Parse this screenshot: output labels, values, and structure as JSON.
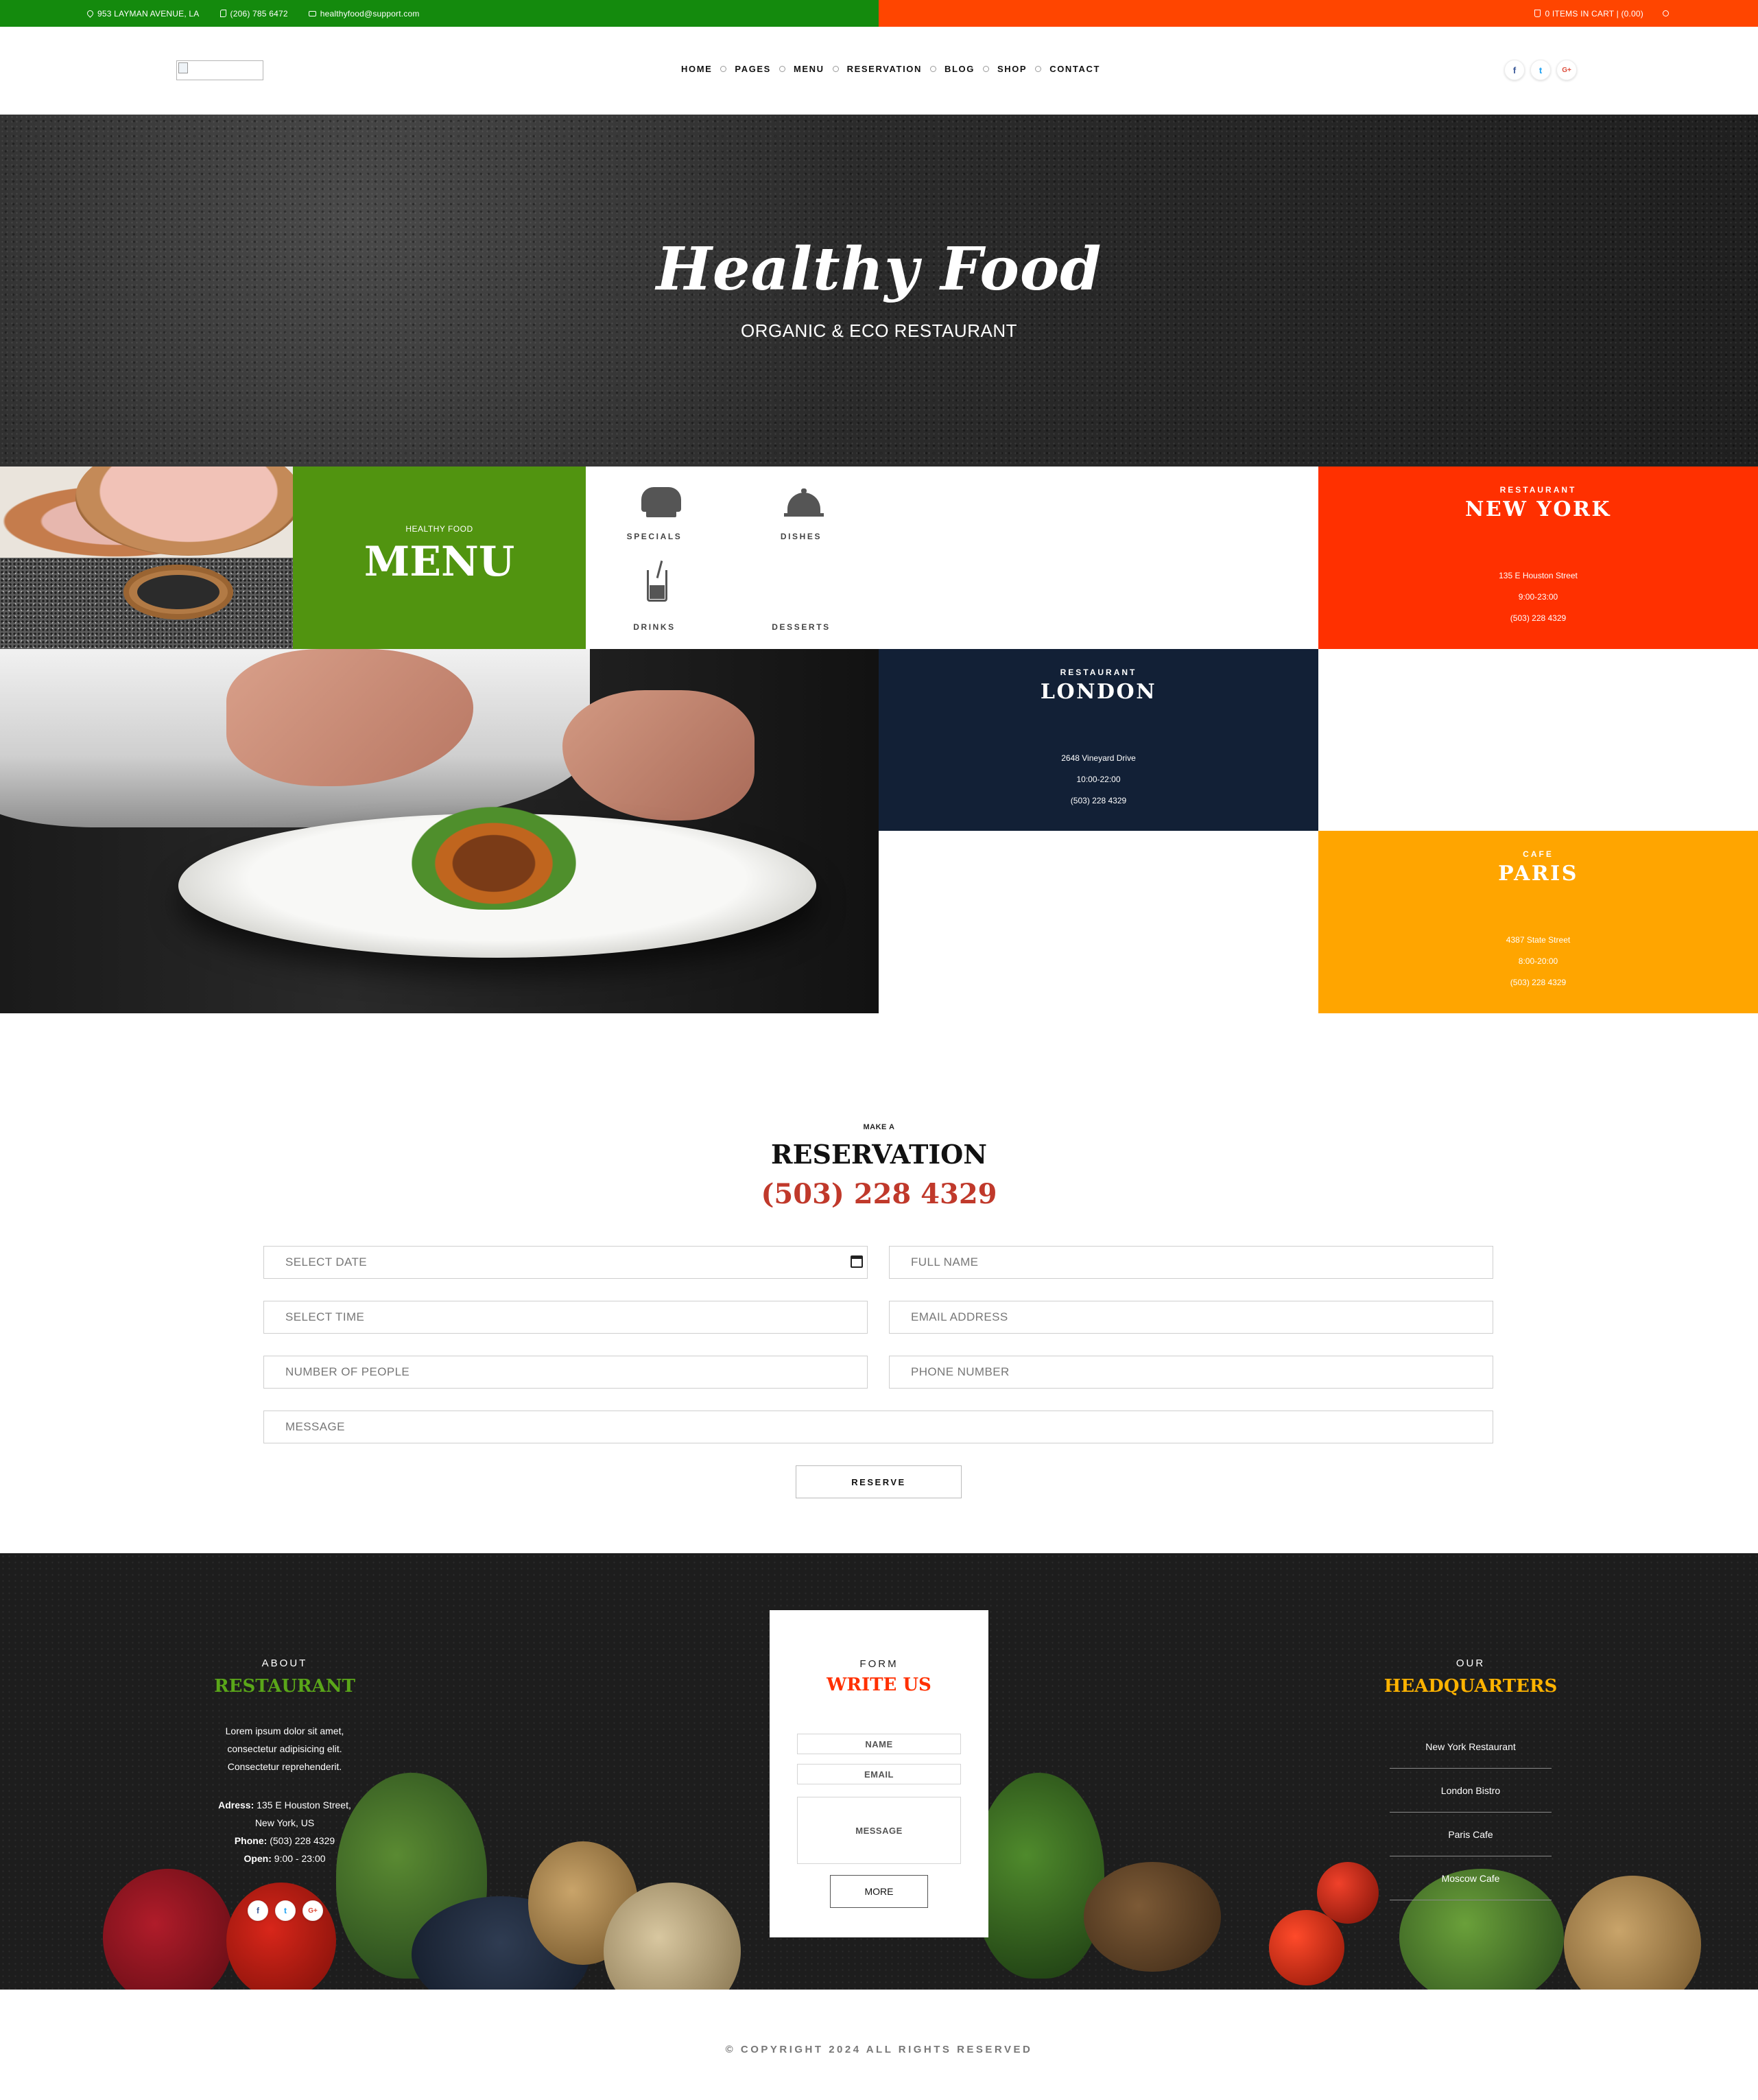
{
  "topbar": {
    "address": "953 LAYMAN AVENUE, LA",
    "phone": "(206) 785 6472",
    "email": "healthyfood@support.com",
    "cart": "0 ITEMS IN CART | (0.00)",
    "colors": {
      "left": "#148a0d",
      "right": "#ff4500"
    }
  },
  "header": {
    "nav": [
      "HOME",
      "PAGES",
      "MENU",
      "RESERVATION",
      "BLOG",
      "SHOP",
      "CONTACT"
    ],
    "social": [
      "f",
      "t",
      "G+"
    ]
  },
  "hero": {
    "title": "Healthy Food",
    "subtitle": "ORGANIC & ECO RESTAURANT"
  },
  "menu_tile": {
    "kicker": "HEALTHY FOOD",
    "title": "MENU",
    "color": "#519410"
  },
  "categories": [
    {
      "label": "SPECIALS",
      "icon": "chef-hat-icon"
    },
    {
      "label": "DISHES",
      "icon": "cloche-icon"
    },
    {
      "label": "DRINKS",
      "icon": "drink-cup-icon"
    },
    {
      "label": "DESSERTS",
      "icon": "dessert-icon"
    }
  ],
  "locations": {
    "new_york": {
      "kicker": "RESTAURANT",
      "name": "NEW YORK",
      "address": "135 E Houston Street",
      "hours": "9:00-23:00",
      "phone": "(503) 228 4329",
      "color": "#ff3000"
    },
    "london": {
      "kicker": "RESTAURANT",
      "name": "LONDON",
      "address": "2648 Vineyard Drive",
      "hours": "10:00-22:00",
      "phone": "(503) 228 4329",
      "color": "#122036"
    },
    "paris": {
      "kicker": "CAFE",
      "name": "PARIS",
      "address": "4387 State Street",
      "hours": "8:00-20:00",
      "phone": "(503) 228 4329",
      "color": "#ffa500"
    }
  },
  "reservation": {
    "kicker": "MAKE A",
    "title": "RESERVATION",
    "phone": "(503) 228 4329",
    "fields": {
      "date": "SELECT DATE",
      "full_name": "FULL NAME",
      "time": "SELECT TIME",
      "email": "EMAIL ADDRESS",
      "people": "NUMBER OF PEOPLE",
      "phone": "PHONE NUMBER",
      "message": "MESSAGE"
    },
    "button": "RESERVE"
  },
  "footer": {
    "about": {
      "kicker": "ABOUT",
      "title": "RESTAURANT",
      "text1": "Lorem ipsum dolor sit amet,",
      "text2": "consectetur adipisicing elit.",
      "text3": "Consectetur reprehenderit.",
      "address_label": "Adress:",
      "address": "135 E Houston Street,",
      "city": "New York, US",
      "phone_label": "Phone:",
      "phone": "(503) 228 4329",
      "open_label": "Open:",
      "open": "9:00 - 23:00",
      "title_color": "#5aa619"
    },
    "form": {
      "kicker": "FORM",
      "title": "WRITE US",
      "name": "NAME",
      "email": "EMAIL",
      "message": "MESSAGE",
      "button": "MORE"
    },
    "hq": {
      "kicker": "OUR",
      "title": "HEADQUARTERS",
      "items": [
        "New York Restaurant",
        "London Bistro",
        "Paris Cafe",
        "Moscow Cafe"
      ],
      "title_color": "#ffb300"
    }
  },
  "copyright": "© COPYRIGHT 2024 ALL RIGHTS RESERVED"
}
